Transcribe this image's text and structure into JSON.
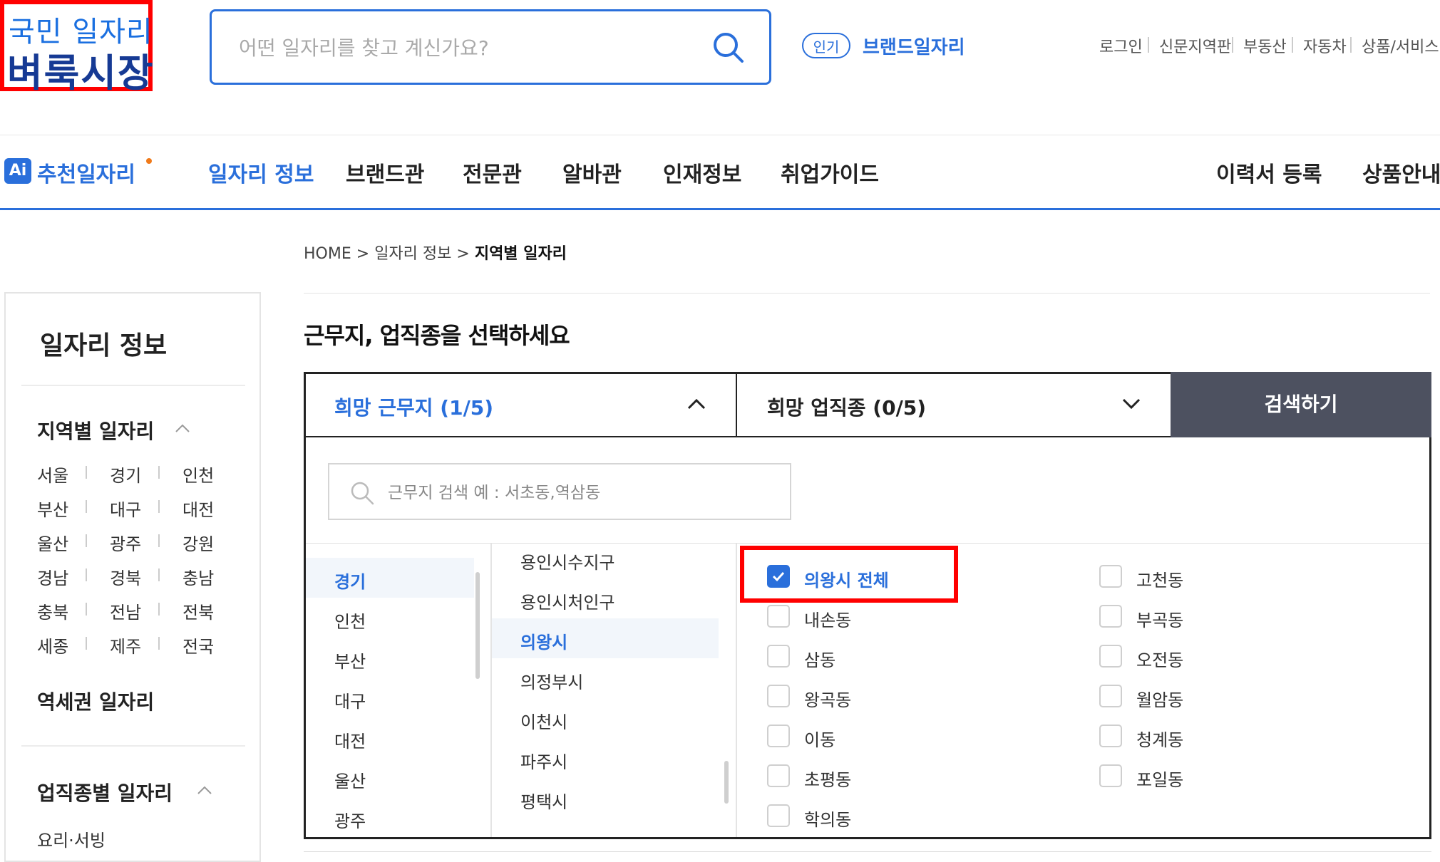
{
  "header": {
    "logo_line1": "국민 일자리",
    "logo_line2": "벼룩시장",
    "search_placeholder": "어떤 일자리를 찾고 계신가요?",
    "popular_badge": "인기",
    "popular_link": "브랜드일자리",
    "util_links": [
      "로그인",
      "신문지역판",
      "부동산",
      "자동차",
      "상품/서비스"
    ]
  },
  "nav": {
    "ai_badge": "Ai",
    "ai_label": "추천일자리",
    "items": [
      "일자리 정보",
      "브랜드관",
      "전문관",
      "알바관",
      "인재정보",
      "취업가이드"
    ],
    "right_items": [
      "이력서 등록",
      "상품안내"
    ]
  },
  "breadcrumb": {
    "home": "HOME",
    "sep": ">",
    "level1": "일자리 정보",
    "current": "지역별 일자리"
  },
  "sidebar": {
    "title": "일자리 정보",
    "section_region": "지역별 일자리",
    "regions": [
      [
        "서울",
        "경기",
        "인천"
      ],
      [
        "부산",
        "대구",
        "대전"
      ],
      [
        "울산",
        "광주",
        "강원"
      ],
      [
        "경남",
        "경북",
        "충남"
      ],
      [
        "충북",
        "전남",
        "전북"
      ],
      [
        "세종",
        "제주",
        "전국"
      ]
    ],
    "section_station": "역세권 일자리",
    "section_job": "업직종별 일자리",
    "job_first": "요리·서빙"
  },
  "main": {
    "title": "근무지, 업직종을 선택하세요",
    "tab_location": "희망 근무지 (1/5)",
    "tab_job": "희망 업직종 (0/5)",
    "search_button": "검색하기",
    "loc_search_placeholder": "근무지 검색 예 : 서초동,역삼동",
    "provinces": [
      "경기",
      "인천",
      "부산",
      "대구",
      "대전",
      "울산",
      "광주"
    ],
    "selected_province": "경기",
    "cities": [
      "용인시수지구",
      "용인시처인구",
      "의왕시",
      "의정부시",
      "이천시",
      "파주시",
      "평택시"
    ],
    "selected_city": "의왕시",
    "districts_left": [
      {
        "label": "의왕시 전체",
        "checked": true
      },
      {
        "label": "내손동",
        "checked": false
      },
      {
        "label": "삼동",
        "checked": false
      },
      {
        "label": "왕곡동",
        "checked": false
      },
      {
        "label": "이동",
        "checked": false
      },
      {
        "label": "초평동",
        "checked": false
      },
      {
        "label": "학의동",
        "checked": false
      }
    ],
    "districts_right": [
      {
        "label": "고천동",
        "checked": false
      },
      {
        "label": "부곡동",
        "checked": false
      },
      {
        "label": "오전동",
        "checked": false
      },
      {
        "label": "월암동",
        "checked": false
      },
      {
        "label": "청계동",
        "checked": false
      },
      {
        "label": "포일동",
        "checked": false
      }
    ]
  },
  "colors": {
    "accent": "#2a6fdb",
    "highlight": "#ff0000",
    "button_dark": "#4d5160"
  }
}
